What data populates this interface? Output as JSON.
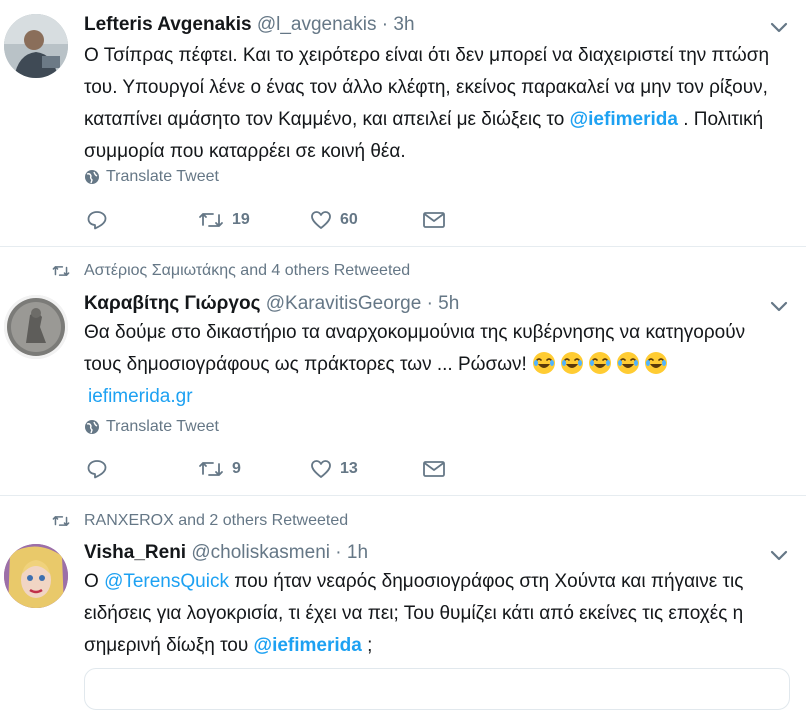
{
  "tweets": [
    {
      "name": "Lefteris Avgenakis",
      "handle": "@l_avgenakis",
      "dot": "·",
      "time": "3h",
      "text": {
        "part1": "Ο Τσίπρας πέφτει. Και το χειρότερο είναι ότι δεν μπορεί να διαχειριστεί την πτώση του. Υπουργοί λένε ο ένας τον άλλο κλέφτη, εκείνος παρακαλεί να μην τον ρίξουν, καταπίνει αμάσητο τον Καμμένο, και απειλεί με διώξεις το ",
        "mention": "@iefimerida",
        "part2": " . Πολιτική συμμορία που καταρρέει σε κοινή θέα."
      },
      "translate_label": "Translate Tweet",
      "retweets": "19",
      "likes": "60"
    },
    {
      "context": "Αστέριος Σαμιωτάκης and 4 others Retweeted",
      "name": "Καραβίτης Γιώργος",
      "handle": "@KaravitisGeorge",
      "dot": "·",
      "time": "5h",
      "text": {
        "part1": "Θα δούμε στο δικαστήριο τα αναρχοκομμούνια της κυβέρνησης να κατηγορούν τους δημοσιογράφους ως πράκτορες των ... Ρώσων! ",
        "link": "iefimerida.gr"
      },
      "emoji": [
        "face-with-tears-of-joy-icon",
        "face-with-tears-of-joy-icon",
        "face-with-tears-of-joy-icon",
        "face-with-tears-of-joy-icon",
        "face-with-tears-of-joy-icon"
      ],
      "translate_label": "Translate Tweet",
      "retweets": "9",
      "likes": "13"
    },
    {
      "context": "RANXEROX and 2 others Retweeted",
      "name": "Visha_Reni",
      "handle": "@choliskasmeni",
      "dot": "·",
      "time": "1h",
      "text": {
        "part1": "Ο ",
        "mention1": "@TerensQuick",
        "part2": "  που ήταν νεαρός δημοσιογράφος στη Χούντα και πήγαινε τις ειδήσεις για λογοκρισία, τι έχει να πει; Του θυμίζει κάτι από εκείνες τις  εποχές η σημερινή δίωξη του ",
        "mention2": "@iefimerida",
        "part3": " ;"
      }
    }
  ],
  "colors": {
    "accent": "#1da1f2",
    "muted": "#657786",
    "text": "#14171a",
    "divider": "#e6ecf0"
  }
}
